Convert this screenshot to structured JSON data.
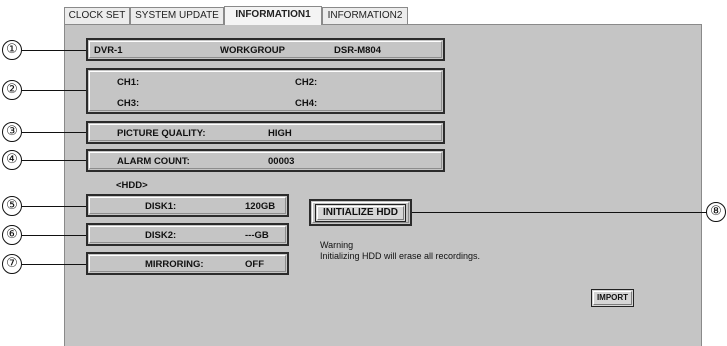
{
  "tabs": [
    "CLOCK SET",
    "SYSTEM UPDATE",
    "INFORMATION1",
    "INFORMATION2"
  ],
  "active_tab": "INFORMATION1",
  "device": {
    "name": "DVR-1",
    "workgroup": "WORKGROUP",
    "model": "DSR-M804"
  },
  "channels": {
    "ch1": "CH1:",
    "ch2": "CH2:",
    "ch3": "CH3:",
    "ch4": "CH4:"
  },
  "picture_quality": {
    "label": "PICTURE QUALITY:",
    "value": "HIGH"
  },
  "alarm_count": {
    "label": "ALARM COUNT:",
    "value": "00003"
  },
  "hdd": {
    "heading": "<HDD>",
    "disk1": {
      "label": "DISK1:",
      "value": "120GB"
    },
    "disk2": {
      "label": "DISK2:",
      "value": "---GB"
    },
    "mirroring": {
      "label": "MIRRORING:",
      "value": "OFF"
    }
  },
  "initialize_button": "INITIALIZE HDD",
  "warning": {
    "title": "Warning",
    "text": "Initializing HDD will erase all recordings."
  },
  "import_button": "IMPORT",
  "callouts": [
    "①",
    "②",
    "③",
    "④",
    "⑤",
    "⑥",
    "⑦",
    "⑧"
  ]
}
